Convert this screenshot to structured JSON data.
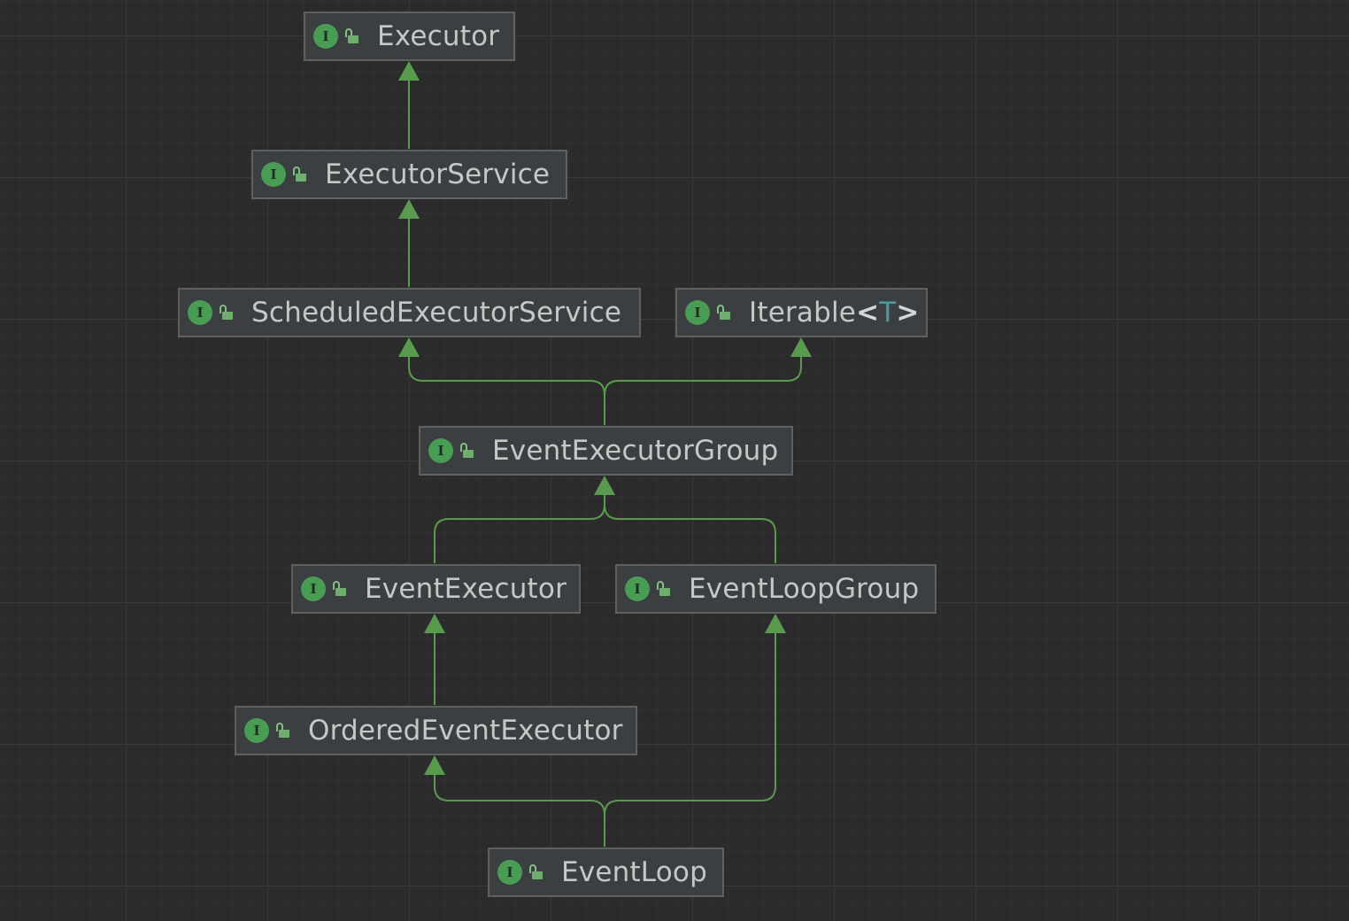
{
  "diagram": {
    "nodes": [
      {
        "id": "executor",
        "label": "Executor",
        "kind": "interface",
        "badge": "I",
        "access": "public"
      },
      {
        "id": "executor-service",
        "label": "ExecutorService",
        "kind": "interface",
        "badge": "I",
        "access": "public"
      },
      {
        "id": "scheduled-executor-service",
        "label": "ScheduledExecutorService",
        "kind": "interface",
        "badge": "I",
        "access": "public"
      },
      {
        "id": "iterable",
        "label": "Iterable",
        "type_param": "T",
        "open": "<",
        "close": ">",
        "kind": "interface",
        "badge": "I",
        "access": "public"
      },
      {
        "id": "event-executor-group",
        "label": "EventExecutorGroup",
        "kind": "interface",
        "badge": "I",
        "access": "public"
      },
      {
        "id": "event-executor",
        "label": "EventExecutor",
        "kind": "interface",
        "badge": "I",
        "access": "public"
      },
      {
        "id": "event-loop-group",
        "label": "EventLoopGroup",
        "kind": "interface",
        "badge": "I",
        "access": "public"
      },
      {
        "id": "ordered-event-executor",
        "label": "OrderedEventExecutor",
        "kind": "interface",
        "badge": "I",
        "access": "public"
      },
      {
        "id": "event-loop",
        "label": "EventLoop",
        "kind": "interface",
        "badge": "I",
        "access": "public"
      }
    ],
    "edges": [
      {
        "from": "executor-service",
        "to": "executor",
        "relation": "extends"
      },
      {
        "from": "scheduled-executor-service",
        "to": "executor-service",
        "relation": "extends"
      },
      {
        "from": "event-executor-group",
        "to": "scheduled-executor-service",
        "relation": "extends"
      },
      {
        "from": "event-executor-group",
        "to": "iterable",
        "relation": "extends"
      },
      {
        "from": "event-executor",
        "to": "event-executor-group",
        "relation": "extends"
      },
      {
        "from": "event-loop-group",
        "to": "event-executor-group",
        "relation": "extends"
      },
      {
        "from": "ordered-event-executor",
        "to": "event-executor",
        "relation": "extends"
      },
      {
        "from": "event-loop",
        "to": "ordered-event-executor",
        "relation": "extends"
      },
      {
        "from": "event-loop",
        "to": "event-loop-group",
        "relation": "extends"
      }
    ]
  },
  "colors": {
    "background": "#2b2b2b",
    "node_fill": "#3c3f41",
    "node_border": "#5e6061",
    "edge": "#5a9a4f",
    "badge": "#499c54",
    "label_text": "#c5c8c6",
    "type_param": "#4a9aa0"
  },
  "icons": {
    "interface_badge": "interface-i-icon",
    "access": "unlocked-padlock-icon"
  }
}
